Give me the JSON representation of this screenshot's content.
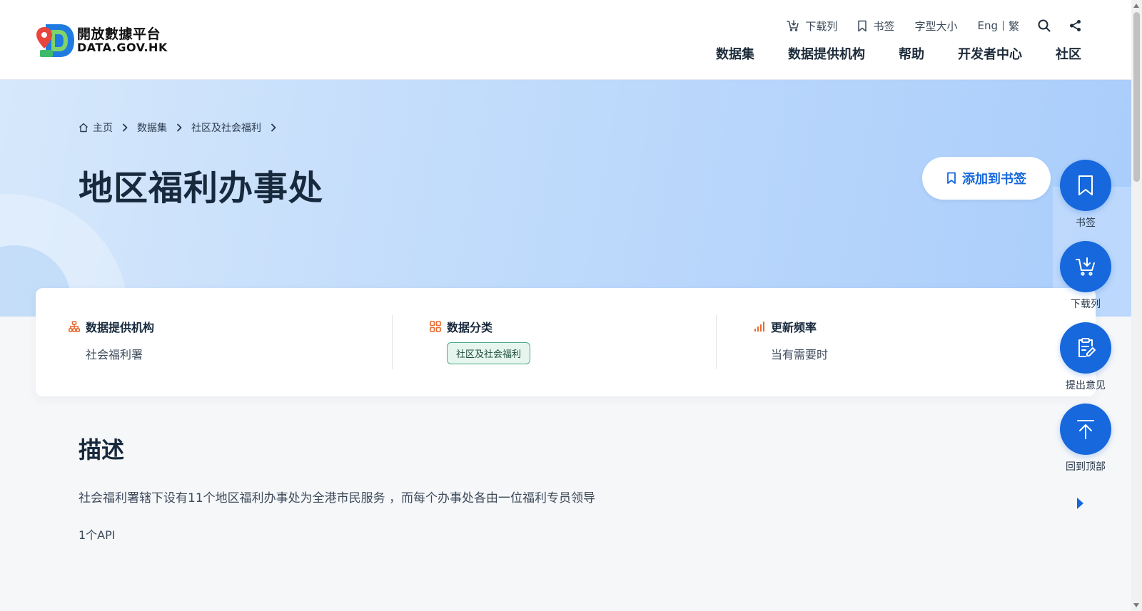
{
  "logo": {
    "name_cn": "開放數據平台",
    "name_en": "DATA.GOV.HK"
  },
  "utility": {
    "download_list": "下载列",
    "bookmarks": "书签",
    "font_size": "字型大小",
    "lang_en": "Eng",
    "lang_tc": "繁"
  },
  "nav": {
    "items": [
      "数据集",
      "数据提供机构",
      "帮助",
      "开发者中心",
      "社区"
    ]
  },
  "breadcrumb": {
    "home": "主页",
    "datasets": "数据集",
    "category": "社区及社会福利"
  },
  "page": {
    "title": "地区福利办事处",
    "add_bookmark": "添加到书签"
  },
  "info": {
    "provider_label": "数据提供机构",
    "provider_value": "社会福利署",
    "category_label": "数据分类",
    "category_value": "社区及社会福利",
    "frequency_label": "更新频率",
    "frequency_value": "当有需要时"
  },
  "description": {
    "heading": "描述",
    "text": "社会福利署辖下设有11个地区福利办事处为全港市民服务 ，而每个办事处各由一位福利专员领导",
    "api_count": "1个API"
  },
  "fab": {
    "bookmark": "书签",
    "download_list": "下载列",
    "feedback": "提出意见",
    "back_to_top": "回到顶部"
  },
  "colors": {
    "primary": "#1668dc",
    "accent_orange": "#e8692e",
    "tag_border": "#4aa886"
  }
}
